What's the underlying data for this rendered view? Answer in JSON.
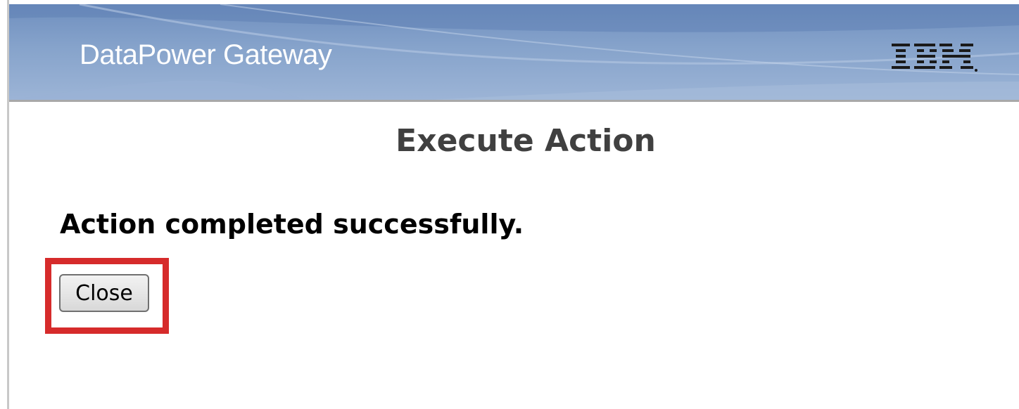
{
  "header": {
    "title": "DataPower Gateway",
    "logo_text": "IBM",
    "logo_icon": "ibm-logo-icon"
  },
  "content": {
    "title": "Execute Action",
    "message": "Action completed successfully.",
    "close_label": "Close"
  },
  "colors": {
    "header_blue": "#7f9dc8",
    "highlight_red": "#d62b2b",
    "title_gray": "#404040"
  }
}
